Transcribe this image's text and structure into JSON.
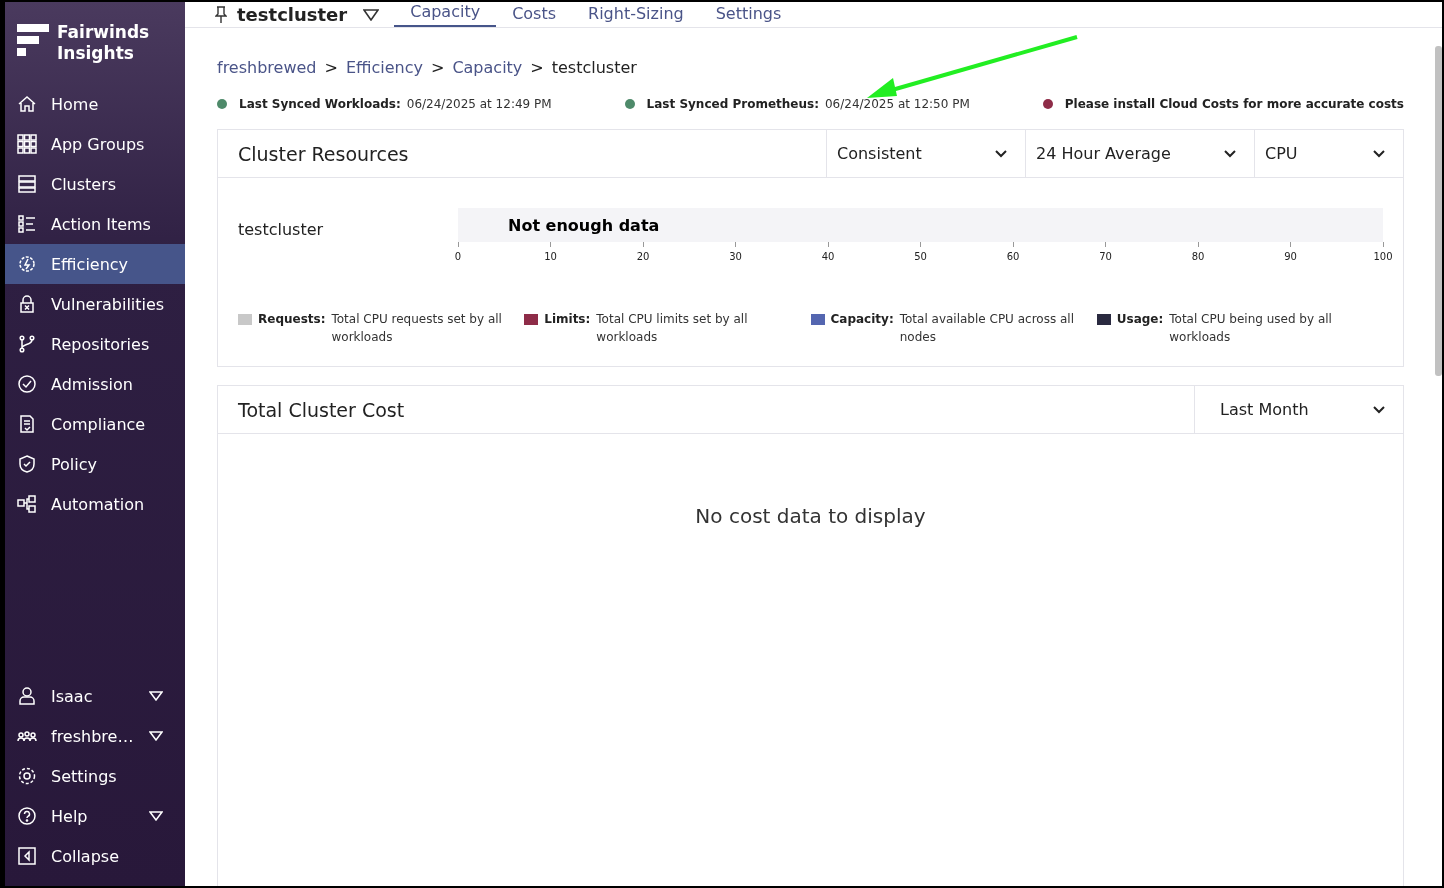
{
  "brand": {
    "line1": "Fairwinds",
    "line2": "Insights"
  },
  "nav": [
    {
      "label": "Home",
      "selected": false
    },
    {
      "label": "App Groups",
      "selected": false
    },
    {
      "label": "Clusters",
      "selected": false
    },
    {
      "label": "Action Items",
      "selected": false
    },
    {
      "label": "Efficiency",
      "selected": true
    },
    {
      "label": "Vulnerabilities",
      "selected": false
    },
    {
      "label": "Repositories",
      "selected": false
    },
    {
      "label": "Admission",
      "selected": false
    },
    {
      "label": "Compliance",
      "selected": false
    },
    {
      "label": "Policy",
      "selected": false
    },
    {
      "label": "Automation",
      "selected": false
    }
  ],
  "nav_bottom": [
    {
      "label": "Isaac",
      "caret": true
    },
    {
      "label": "freshbre…",
      "caret": true
    },
    {
      "label": "Settings",
      "caret": false
    },
    {
      "label": "Help",
      "caret": true
    },
    {
      "label": "Collapse",
      "caret": false
    }
  ],
  "cluster_selector": "testcluster",
  "tabs": [
    {
      "label": "Capacity",
      "selected": true
    },
    {
      "label": "Costs",
      "selected": false
    },
    {
      "label": "Right-Sizing",
      "selected": false
    },
    {
      "label": "Settings",
      "selected": false
    }
  ],
  "breadcrumb": [
    {
      "label": "freshbrewed",
      "link": true
    },
    {
      "label": "Efficiency",
      "link": true
    },
    {
      "label": "Capacity",
      "link": true
    },
    {
      "label": "testcluster",
      "link": false
    }
  ],
  "breadcrumb_separator": ">",
  "sync_status": [
    {
      "label": "Last Synced Workloads:",
      "value": "06/24/2025 at 12:49 PM",
      "color": "#4e8a6a"
    },
    {
      "label": "Last Synced Prometheus:",
      "value": "06/24/2025 at 12:50 PM",
      "color": "#4e8a6a"
    },
    {
      "label": "Please install Cloud Costs for more accurate costs",
      "color": "#8e2c48"
    }
  ],
  "cluster_resources": {
    "title": "Cluster Resources",
    "dropdowns": [
      "Consistent",
      "24 Hour Average",
      "CPU"
    ],
    "row_label": "testcluster",
    "message": "Not enough data",
    "axis_ticks": [
      "0",
      "10",
      "20",
      "30",
      "40",
      "50",
      "60",
      "70",
      "80",
      "90",
      "100"
    ],
    "legend": [
      {
        "name": "Requests:",
        "description": "Total CPU requests set by all workloads",
        "color": "#c8c8c8"
      },
      {
        "name": "Limits:",
        "description": "Total CPU limits set by all workloads",
        "color": "#8e2c48"
      },
      {
        "name": "Capacity:",
        "description": "Total available CPU across all nodes",
        "color": "#5466b0"
      },
      {
        "name": "Usage:",
        "description": "Total CPU being used by all workloads",
        "color": "#2a2a40"
      }
    ]
  },
  "total_cluster_cost": {
    "title": "Total Cluster Cost",
    "dropdown": "Last Month",
    "empty_message": "No cost data to display"
  }
}
